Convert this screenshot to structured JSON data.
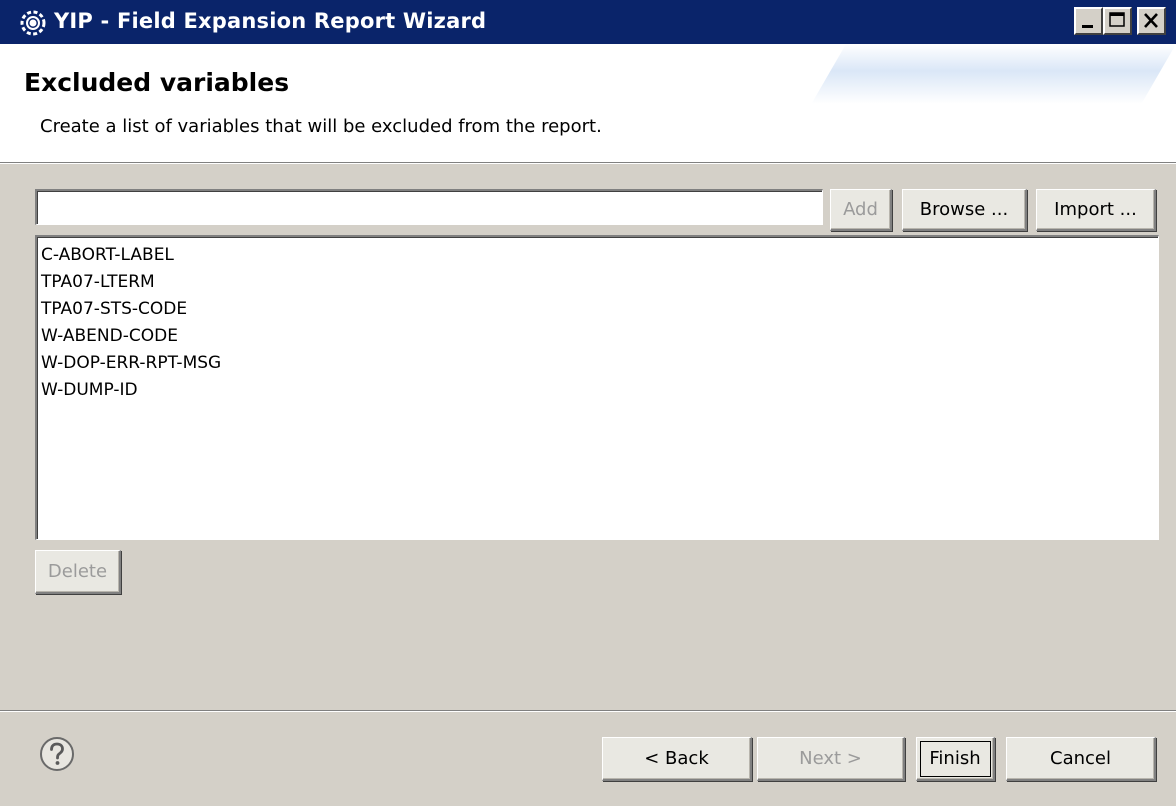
{
  "window": {
    "title": "YIP  -  Field Expansion Report Wizard",
    "icons": {
      "app": "gear-icon",
      "minimize": "minimize-icon",
      "maximize": "maximize-icon",
      "close": "close-icon"
    }
  },
  "header": {
    "title": "Excluded variables",
    "description": "Create a list of variables that will be excluded from the report."
  },
  "variable_input": {
    "value": "",
    "placeholder": ""
  },
  "buttons": {
    "add": "Add",
    "browse": "Browse ...",
    "import": "Import ...",
    "delete": "Delete"
  },
  "excluded_variables": [
    "C-ABORT-LABEL",
    "TPA07-LTERM",
    "TPA07-STS-CODE",
    "W-ABEND-CODE",
    "W-DOP-ERR-RPT-MSG",
    "W-DUMP-ID"
  ],
  "footer": {
    "help_icon": "help-icon",
    "back": "< Back",
    "next": "Next >",
    "finish": "Finish",
    "cancel": "Cancel"
  },
  "colors": {
    "titlebar": "#0a246a",
    "dialog_bg": "#d4d0c8",
    "disabled_text": "#9b9b9b"
  }
}
